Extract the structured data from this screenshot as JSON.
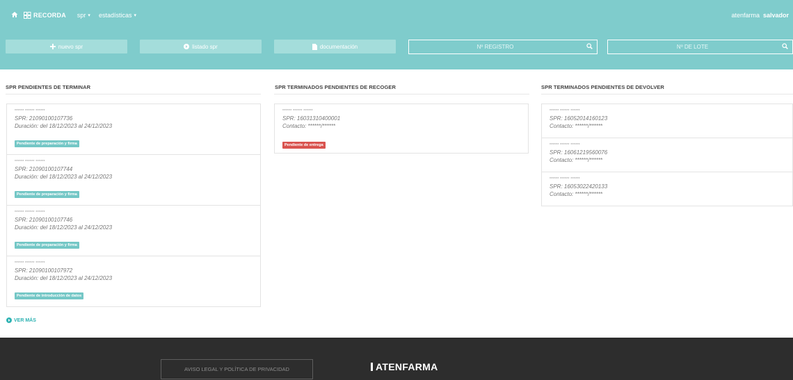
{
  "navbar": {
    "home_icon": "home-icon",
    "brand_icon": "records-grid-icon",
    "brand": "RECORDA",
    "menu": [
      {
        "label": "spr"
      },
      {
        "label": "estadísticas"
      }
    ],
    "user": {
      "org": "atenfarma",
      "name": "salvador"
    }
  },
  "actions": {
    "new_spr": {
      "icon": "plus-icon",
      "label": "nuevo spr"
    },
    "list_spr": {
      "icon": "circle-arrow-icon",
      "label": "listado spr"
    },
    "docs": {
      "icon": "file-icon",
      "label": "documentación"
    },
    "search_registro": {
      "placeholder": "Nº REGISTRO",
      "icon": "search-icon"
    },
    "search_lote": {
      "placeholder": "Nº DE LOTE",
      "icon": "search-icon"
    }
  },
  "columns": {
    "pendientes_terminar": {
      "title": "SPR PENDIENTES DE TERMINAR",
      "items": [
        {
          "masked": "****** ****** ******",
          "code": "SPR: 21090100107736",
          "duration": "Duración: del 18/12/2023 al 24/12/2023",
          "status": "Pendiente de preparación y firma"
        },
        {
          "masked": "****** ****** ******",
          "code": "SPR: 21090100107744",
          "duration": "Duración: del 18/12/2023 al 24/12/2023",
          "status": "Pendiente de preparación y firma"
        },
        {
          "masked": "****** ****** ******",
          "code": "SPR: 21090100107746",
          "duration": "Duración: del 18/12/2023 al 24/12/2023",
          "status": "Pendiente de preparación y firma"
        },
        {
          "masked": "****** ****** ******",
          "code": "SPR: 21090100107972",
          "duration": "Duración: del 18/12/2023 al 24/12/2023",
          "status": "Pendiente de introducción de datos"
        }
      ],
      "more": "VER MÁS"
    },
    "pendientes_recoger": {
      "title": "SPR TERMINADOS PENDIENTES DE RECOGER",
      "items": [
        {
          "masked": "****** ****** ******",
          "code": "SPR: 16031310400001",
          "contact": "Contacto: ******/******",
          "status": "Pendiente de entrega"
        }
      ]
    },
    "pendientes_devolver": {
      "title": "SPR TERMINADOS PENDIENTES DE DEVOLVER",
      "items": [
        {
          "masked": "****** ****** ******",
          "code": "SPR: 16052014160123",
          "contact": "Contacto: ******/******"
        },
        {
          "masked": "****** ****** ******",
          "code": "SPR: 16061219560076",
          "contact": "Contacto: ******/******"
        },
        {
          "masked": "****** ****** ******",
          "code": "SPR: 16053022420133",
          "contact": "Contacto: ******/******"
        }
      ]
    }
  },
  "footer": {
    "legal": "AVISO LEGAL Y POLÍTICA DE PRIVACIDAD",
    "logo": "ATENFARMA"
  },
  "colors": {
    "teal_band": "#7fcccc",
    "button": "#a4dddb",
    "badge_teal": "#74c7c6",
    "badge_red": "#d9534f",
    "footer": "#2d2d2d",
    "link": "#2fb3b3"
  }
}
